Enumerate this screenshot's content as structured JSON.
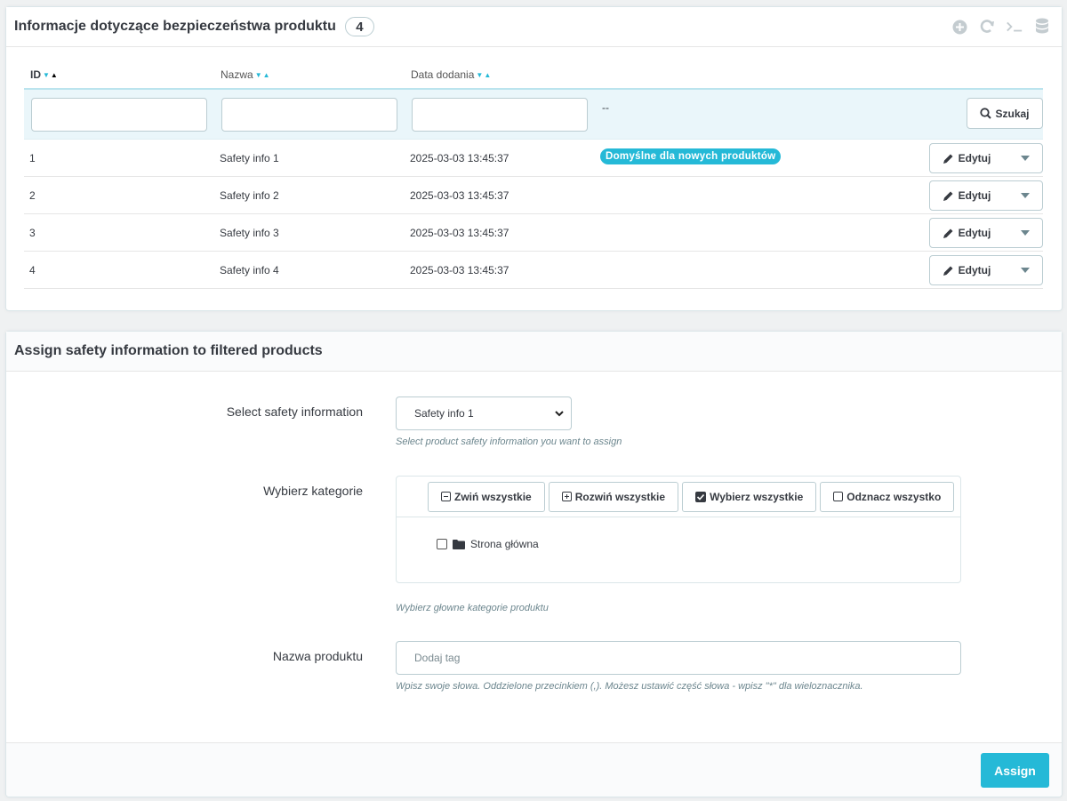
{
  "list_panel": {
    "title": "Informacje dotyczące bezpieczeństwa produktu",
    "count": "4",
    "toolbar_icons": [
      "add-circle-icon",
      "refresh-icon",
      "terminal-icon",
      "database-icon"
    ],
    "columns": {
      "id": "ID",
      "name": "Nazwa",
      "date": "Data dodania"
    },
    "filter_dash": "--",
    "search_label": "Szukaj",
    "rows": [
      {
        "id": "1",
        "name": "Safety info 1",
        "date": "2025-03-03 13:45:37",
        "badge": "Domyślne dla nowych produktów",
        "action": "Edytuj"
      },
      {
        "id": "2",
        "name": "Safety info 2",
        "date": "2025-03-03 13:45:37",
        "badge": "",
        "action": "Edytuj"
      },
      {
        "id": "3",
        "name": "Safety info 3",
        "date": "2025-03-03 13:45:37",
        "badge": "",
        "action": "Edytuj"
      },
      {
        "id": "4",
        "name": "Safety info 4",
        "date": "2025-03-03 13:45:37",
        "badge": "",
        "action": "Edytuj"
      }
    ]
  },
  "assign_panel": {
    "title": "Assign safety information to filtered products",
    "select_label": "Select safety information",
    "select_value": "Safety info 1",
    "select_help": "Select product safety information you want to assign",
    "category_label": "Wybierz kategorie",
    "tree_buttons": {
      "collapse": "Zwiń wszystkie",
      "expand": "Rozwiń wszystkie",
      "select_all": "Wybierz wszystkie",
      "unselect_all": "Odznacz wszystko"
    },
    "tree_root": "Strona główna",
    "category_help": "Wybierz głowne kategorie produktu",
    "product_label": "Nazwa produktu",
    "product_placeholder": "Dodaj tag",
    "product_help": "Wpisz swoje słowa. Oddzielone przecinkiem (,). Możesz ustawić część słowa - wpisz \"*\" dla wieloznacznika.",
    "submit_label": "Assign"
  },
  "colors": {
    "accent": "#25b9d7",
    "filter_bg": "#eaf6fa",
    "page_bg": "#eff1f2"
  }
}
